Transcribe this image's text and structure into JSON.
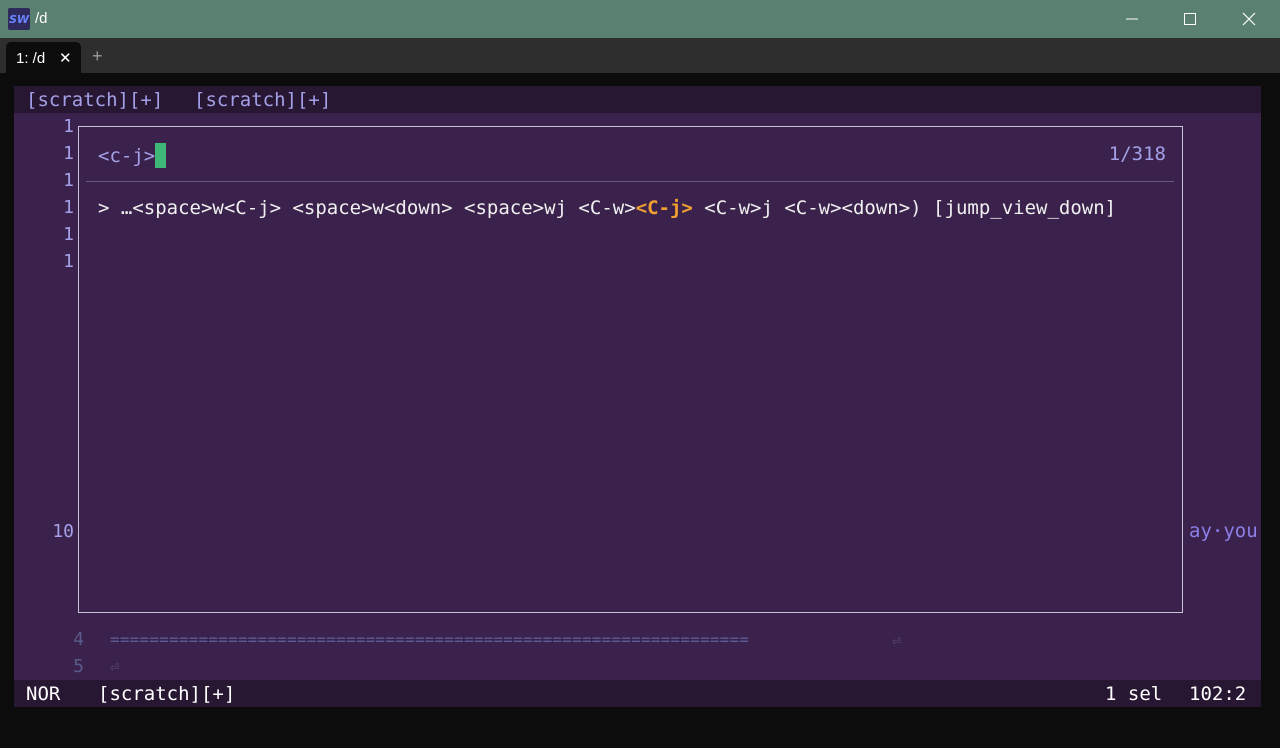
{
  "window": {
    "icon_text": "SW",
    "title": "/d"
  },
  "tabs": {
    "items": [
      {
        "label": "1: /d"
      }
    ]
  },
  "bufferline": {
    "buffers": [
      "[scratch][+]",
      "[scratch][+]"
    ]
  },
  "gutter": {
    "line_numbers": [
      "1",
      "1",
      "1",
      "1",
      "1",
      "1",
      "10",
      "4",
      "5"
    ]
  },
  "picker": {
    "query": "<c-j>",
    "count": "1/318",
    "result": {
      "prefix": "> …<space>w<C-j> <space>w<down> <space>wj <C-w>",
      "match": "<C-j>",
      "suffix": " <C-w>j <C-w><down>) [jump_view_down]"
    }
  },
  "buffer_text": {
    "right_fragment": "ay·you",
    "ruler": "=================================================================",
    "eol_symbol": "⏎"
  },
  "statusline": {
    "mode": "NOR",
    "buffer": "[scratch][+]",
    "selections": "1 sel",
    "position": "102:2"
  },
  "colors": {
    "titlebar": "#5a8070",
    "editor_bg": "#3b224c",
    "bar_bg": "#281733",
    "text": "#a4a0e8",
    "match_highlight": "#f0a030",
    "cursor": "#3fb877"
  }
}
